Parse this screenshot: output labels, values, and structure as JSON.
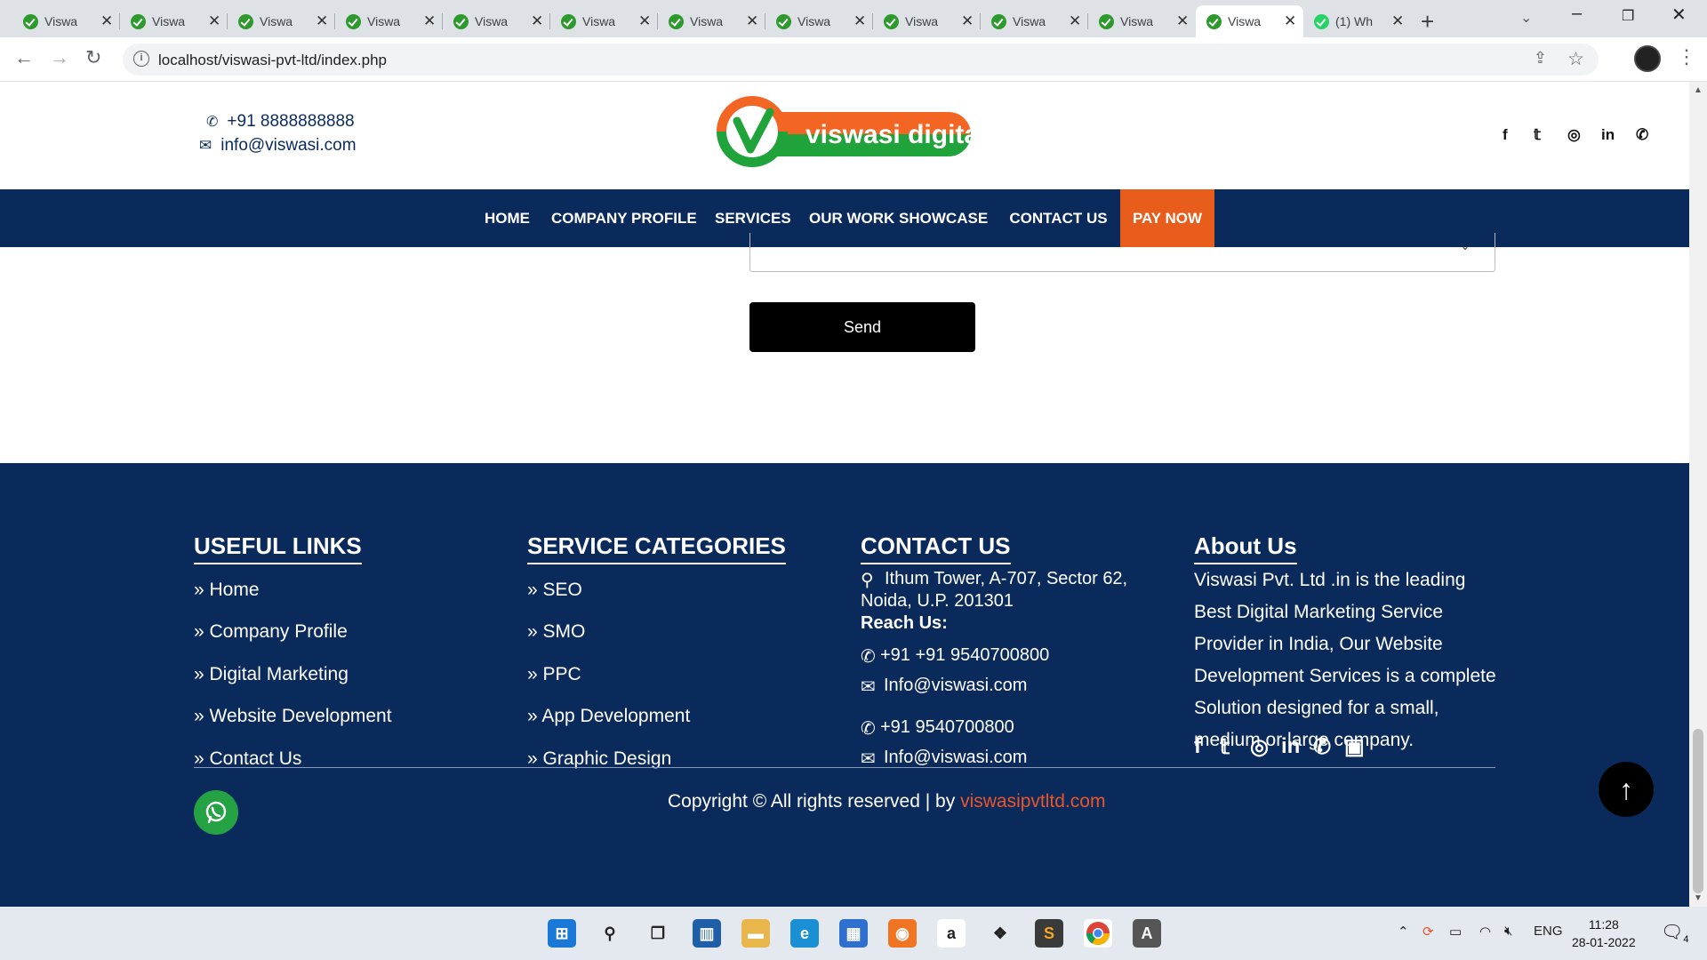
{
  "browser": {
    "tabs": [
      {
        "title": "Viswa",
        "favicon": "viswasi-check-icon",
        "active": false
      },
      {
        "title": "Viswa",
        "favicon": "viswasi-check-icon",
        "active": false
      },
      {
        "title": "Viswa",
        "favicon": "viswasi-check-icon",
        "active": false
      },
      {
        "title": "Viswa",
        "favicon": "viswasi-check-icon",
        "active": false
      },
      {
        "title": "Viswa",
        "favicon": "viswasi-check-icon",
        "active": false
      },
      {
        "title": "Viswa",
        "favicon": "viswasi-check-icon",
        "active": false
      },
      {
        "title": "Viswa",
        "favicon": "viswasi-check-icon",
        "active": false
      },
      {
        "title": "Viswa",
        "favicon": "viswasi-check-icon",
        "active": false
      },
      {
        "title": "Viswa",
        "favicon": "viswasi-check-icon",
        "active": false
      },
      {
        "title": "Viswa",
        "favicon": "viswasi-check-icon",
        "active": false
      },
      {
        "title": "Viswa",
        "favicon": "viswasi-check-icon",
        "active": false
      },
      {
        "title": "Viswa",
        "favicon": "viswasi-check-icon",
        "active": true
      },
      {
        "title": "(1) Wh",
        "favicon": "whatsapp-icon",
        "active": false
      }
    ],
    "url": "localhost/viswasi-pvt-ltd/index.php"
  },
  "site": {
    "topbar": {
      "phone": "+91 8888888888",
      "email": "info@viswasi.com",
      "logo_text": "viswasi digital"
    },
    "nav": {
      "items": [
        "HOME",
        "COMPANY PROFILE",
        "SERVICES",
        "OUR WORK SHOWCASE",
        "CONTACT US",
        "PAY NOW"
      ]
    },
    "form": {
      "send_label": "Send"
    },
    "footer": {
      "useful_links": {
        "title": "USEFUL LINKS",
        "items": [
          "» Home",
          "» Company Profile",
          "» Digital Marketing",
          "» Website Development",
          "» Contact Us"
        ]
      },
      "service_categories": {
        "title": "SERVICE CATEGORIES",
        "items": [
          "» SEO",
          "» SMO",
          "» PPC",
          "» App Development",
          "» Graphic Design"
        ]
      },
      "contact": {
        "title": "CONTACT US",
        "address_line1": "Ithum Tower, A-707, Sector 62,",
        "address_line2": "Noida, U.P. 201301",
        "reach_label": "Reach Us:",
        "phone1": "+91 +91 9540700800",
        "email1": "Info@viswasi.com",
        "phone2": "+91 9540700800",
        "email2": "Info@viswasi.com"
      },
      "about": {
        "title": "About Us",
        "text": "Viswasi Pvt. Ltd .in is the leading Best Digital Marketing Service Provider in India, Our Website Development Services is a complete Solution designed for a small, medium or large company."
      },
      "copyright": "Copyright © All rights reserved | by ",
      "copyright_brand": "viswasipvtltd.com"
    }
  },
  "taskbar": {
    "language": "ENG",
    "time": "11:28",
    "date": "28-01-2022",
    "notification_count": "4"
  },
  "colors": {
    "navy": "#0a2a5c",
    "pay_orange": "#e85c1c",
    "brand_link": "#e8562a",
    "logo_green": "#1fa33a",
    "logo_orange": "#f26522"
  }
}
